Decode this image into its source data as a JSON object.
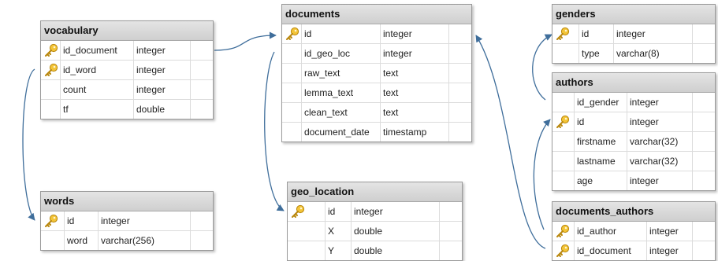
{
  "tables": {
    "vocabulary": {
      "title": "vocabulary",
      "columns": [
        {
          "name": "id_document",
          "type": "integer",
          "pk": true
        },
        {
          "name": "id_word",
          "type": "integer",
          "pk": true
        },
        {
          "name": "count",
          "type": "integer",
          "pk": false
        },
        {
          "name": "tf",
          "type": "double",
          "pk": false
        }
      ]
    },
    "documents": {
      "title": "documents",
      "columns": [
        {
          "name": "id",
          "type": "integer",
          "pk": true
        },
        {
          "name": "id_geo_loc",
          "type": "integer",
          "pk": false
        },
        {
          "name": "raw_text",
          "type": "text",
          "pk": false
        },
        {
          "name": "lemma_text",
          "type": "text",
          "pk": false
        },
        {
          "name": "clean_text",
          "type": "text",
          "pk": false
        },
        {
          "name": "document_date",
          "type": "timestamp",
          "pk": false
        }
      ]
    },
    "genders": {
      "title": "genders",
      "columns": [
        {
          "name": "id",
          "type": "integer",
          "pk": true
        },
        {
          "name": "type",
          "type": "varchar(8)",
          "pk": false
        }
      ]
    },
    "authors": {
      "title": "authors",
      "columns": [
        {
          "name": "id_gender",
          "type": "integer",
          "pk": false
        },
        {
          "name": "id",
          "type": "integer",
          "pk": true
        },
        {
          "name": "firstname",
          "type": "varchar(32)",
          "pk": false
        },
        {
          "name": "lastname",
          "type": "varchar(32)",
          "pk": false
        },
        {
          "name": "age",
          "type": "integer",
          "pk": false
        }
      ]
    },
    "words": {
      "title": "words",
      "columns": [
        {
          "name": "id",
          "type": "integer",
          "pk": true
        },
        {
          "name": "word",
          "type": "varchar(256)",
          "pk": false
        }
      ]
    },
    "geo_location": {
      "title": "geo_location",
      "columns": [
        {
          "name": "id",
          "type": "integer",
          "pk": true
        },
        {
          "name": "X",
          "type": "double",
          "pk": false
        },
        {
          "name": "Y",
          "type": "double",
          "pk": false
        }
      ]
    },
    "documents_authors": {
      "title": "documents_authors",
      "columns": [
        {
          "name": "id_author",
          "type": "integer",
          "pk": true
        },
        {
          "name": "id_document",
          "type": "integer",
          "pk": true
        }
      ]
    }
  },
  "colors": {
    "link": "#3f6e9b",
    "key": "#e8b422"
  }
}
